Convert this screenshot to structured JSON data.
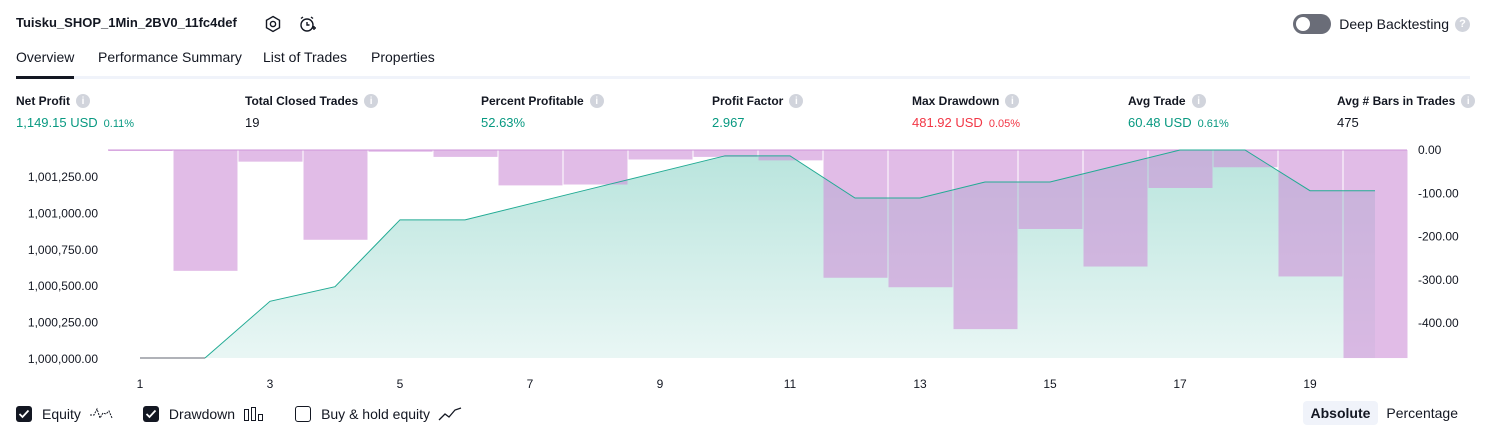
{
  "header": {
    "title": "Tuisku_SHOP_1Min_2BV0_11fc4def",
    "deep_backtesting_label": "Deep Backtesting",
    "deep_backtesting_enabled": false
  },
  "tabs": [
    {
      "label": "Overview",
      "active": true
    },
    {
      "label": "Performance Summary",
      "active": false
    },
    {
      "label": "List of Trades",
      "active": false
    },
    {
      "label": "Properties",
      "active": false
    }
  ],
  "metrics": [
    {
      "label": "Net Profit",
      "value": "1,149.15 USD",
      "sub": "0.11%"
    },
    {
      "label": "Total Closed Trades",
      "value": "19",
      "sub": ""
    },
    {
      "label": "Percent Profitable",
      "value": "52.63%",
      "sub": ""
    },
    {
      "label": "Profit Factor",
      "value": "2.967",
      "sub": ""
    },
    {
      "label": "Max Drawdown",
      "value": "481.92 USD",
      "sub": "0.05%"
    },
    {
      "label": "Avg Trade",
      "value": "60.48 USD",
      "sub": "0.61%"
    },
    {
      "label": "Avg # Bars in Trades",
      "value": "475",
      "sub": ""
    }
  ],
  "colors": {
    "profit": "#089981",
    "loss": "#f23645",
    "equity_line": "#22ab94",
    "drawdown_bar": "#ce93d8"
  },
  "chart_data": {
    "type": "area",
    "x_ticks": [
      "1",
      "3",
      "5",
      "7",
      "9",
      "11",
      "13",
      "15",
      "17",
      "19"
    ],
    "left_ticks": [
      "1,001,250.00",
      "1,001,000.00",
      "1,000,750.00",
      "1,000,500.00",
      "1,000,250.00",
      "1,000,000.00"
    ],
    "right_ticks": [
      "0.00",
      "-100.00",
      "-200.00",
      "-300.00",
      "-400.00"
    ],
    "equity_ylim": [
      1000000,
      1001430
    ],
    "drawdown_ylim": [
      -481.92,
      0
    ],
    "series": [
      {
        "name": "Equity",
        "x": [
          1,
          2,
          3,
          4,
          5,
          6,
          7,
          8,
          9,
          10,
          11,
          12,
          13,
          14,
          15,
          16,
          17,
          18,
          19,
          20
        ],
        "values": [
          1000000,
          1000000,
          1000390,
          1000490,
          1000950,
          1000950,
          1001060,
          1001170,
          1001280,
          1001390,
          1001390,
          1001100,
          1001100,
          1001210,
          1001210,
          1001320,
          1001430,
          1001430,
          1001150,
          1001150
        ]
      },
      {
        "name": "Drawdown",
        "x": [
          1,
          2,
          3,
          4,
          5,
          6,
          7,
          8,
          9,
          10,
          11,
          12,
          13,
          14,
          15,
          16,
          17,
          18,
          19,
          20
        ],
        "values": [
          -2,
          -280,
          -27,
          -208,
          -4,
          -16,
          -82,
          -80,
          -22,
          -16,
          -24,
          -296,
          -318,
          -415,
          -183,
          -270,
          -88,
          -40,
          -293,
          -482
        ]
      }
    ]
  },
  "legend": [
    {
      "label": "Equity",
      "checked": true,
      "icon": "equity-icon"
    },
    {
      "label": "Drawdown",
      "checked": true,
      "icon": "drawdown-icon"
    },
    {
      "label": "Buy & hold equity",
      "checked": false,
      "icon": "buy-hold-icon"
    }
  ],
  "modes": [
    {
      "label": "Absolute",
      "active": true
    },
    {
      "label": "Percentage",
      "active": false
    }
  ]
}
